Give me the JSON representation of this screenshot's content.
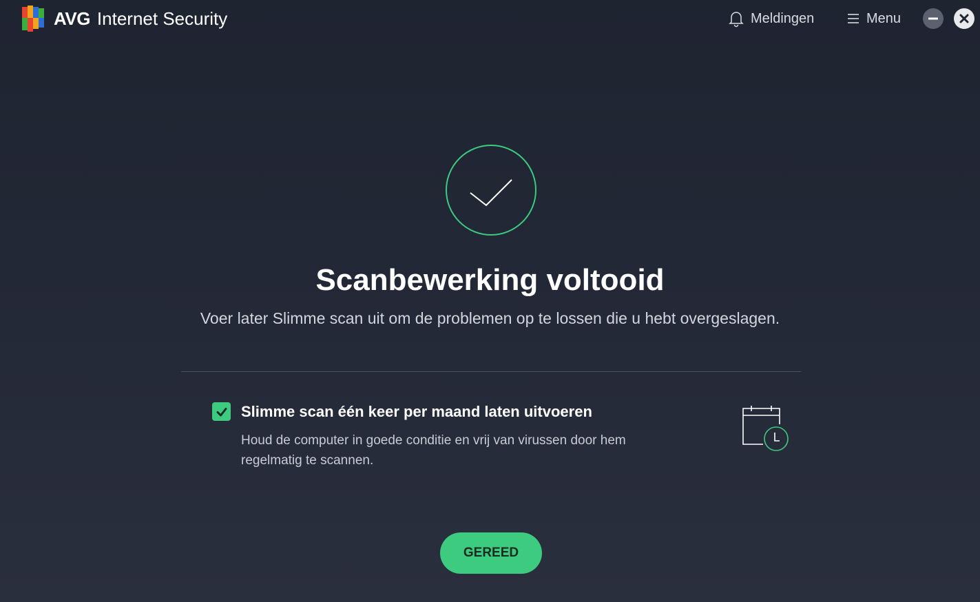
{
  "header": {
    "brand_name": "AVG",
    "product_name": "Internet Security",
    "notifications_label": "Meldingen",
    "menu_label": "Menu"
  },
  "main": {
    "title": "Scanbewerking voltooid",
    "subtitle": "Voer later Slimme scan uit om de problemen op te lossen die u hebt overgeslagen."
  },
  "option": {
    "checked": true,
    "title": "Slimme scan één keer per maand laten uitvoeren",
    "description": "Houd de computer in goede conditie en vrij van virussen door hem regelmatig te scannen."
  },
  "actions": {
    "done_label": "GEREED"
  },
  "colors": {
    "accent": "#3ccb7f",
    "background": "#232836"
  },
  "icons": {
    "logo": "avg-logo",
    "notifications": "bell-icon",
    "menu": "hamburger-icon",
    "minimize": "minimize-icon",
    "close": "close-icon",
    "status": "checkmark-circle-icon",
    "checkbox": "checkmark-icon",
    "schedule": "calendar-clock-icon"
  }
}
